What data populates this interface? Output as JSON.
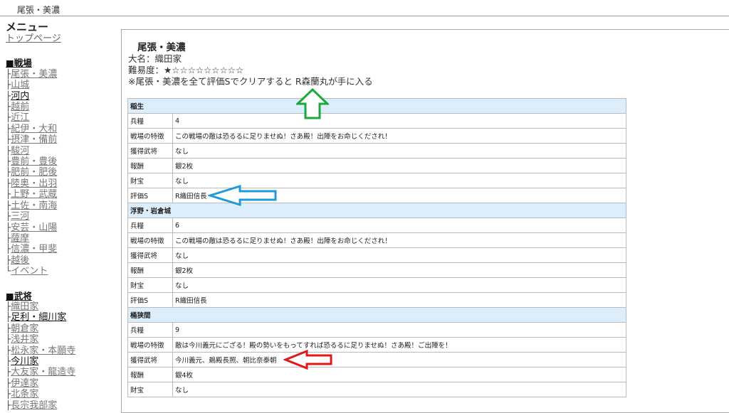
{
  "breadcrumb": "尾張・美濃",
  "sidebar": {
    "menu_title": "メニュー",
    "top_link": "トップページ",
    "sections": [
      {
        "title": "■戦場",
        "items": [
          {
            "tee": "├",
            "label": "尾張・美濃"
          },
          {
            "tee": "├",
            "label": "山城"
          },
          {
            "tee": "├",
            "label": "河内"
          },
          {
            "tee": "├",
            "label": "越前"
          },
          {
            "tee": "├",
            "label": "近江"
          },
          {
            "tee": "├",
            "label": "紀伊・大和"
          },
          {
            "tee": "├",
            "label": "摂津・備前"
          },
          {
            "tee": "├",
            "label": "駿河"
          },
          {
            "tee": "├",
            "label": "豊前・豊後"
          },
          {
            "tee": "├",
            "label": "肥前・肥後"
          },
          {
            "tee": "├",
            "label": "陸奥・出羽"
          },
          {
            "tee": "├",
            "label": "上野・武蔵"
          },
          {
            "tee": "├",
            "label": "土佐・南海"
          },
          {
            "tee": "├",
            "label": "三河"
          },
          {
            "tee": "├",
            "label": "安芸・山陽"
          },
          {
            "tee": "├",
            "label": "薩摩"
          },
          {
            "tee": "├",
            "label": "信濃・甲斐"
          },
          {
            "tee": "├",
            "label": "越後"
          },
          {
            "tee": "└",
            "label": "イベント"
          }
        ]
      },
      {
        "title": "■武将",
        "items": [
          {
            "tee": "├",
            "label": "織田家"
          },
          {
            "tee": "├",
            "label": "足利・細川家"
          },
          {
            "tee": "├",
            "label": "朝倉家"
          },
          {
            "tee": "├",
            "label": "浅井家"
          },
          {
            "tee": "├",
            "label": "松永家・本願寺"
          },
          {
            "tee": "├",
            "label": "今川家"
          },
          {
            "tee": "├",
            "label": "大友家・龍造寺"
          },
          {
            "tee": "├",
            "label": "伊達家"
          },
          {
            "tee": "├",
            "label": "北条家"
          },
          {
            "tee": "├",
            "label": "長宗我部家"
          }
        ]
      }
    ]
  },
  "main": {
    "title": "尾張・美濃",
    "daimyo": "大名：織田家",
    "difficulty": "難易度：★☆☆☆☆☆☆☆☆☆",
    "note": "※尾張・美濃を全て評価Sでクリアすると R森蘭丸が手に入る",
    "rows": [
      {
        "hdr": true,
        "k": "稲生",
        "v": ""
      },
      {
        "k": "兵糧",
        "v": "4"
      },
      {
        "k": "戦場の特徴",
        "v": "この戦場の敵は恐るるに足りませぬ！さあ殿！出陣をお命じくだされ！"
      },
      {
        "k": "獲得武将",
        "v": "なし"
      },
      {
        "k": "報酬",
        "v": "銀2枚"
      },
      {
        "k": "財宝",
        "v": "なし"
      },
      {
        "k": "評価S",
        "v": "R織田信長"
      },
      {
        "hdr": true,
        "k": "浮野・岩倉城",
        "v": ""
      },
      {
        "k": "兵糧",
        "v": "6"
      },
      {
        "k": "戦場の特徴",
        "v": "この戦場の敵は恐るるに足りませぬ！さあ殿！出陣をお命じくだされ！"
      },
      {
        "k": "獲得武将",
        "v": "なし"
      },
      {
        "k": "報酬",
        "v": "銀2枚"
      },
      {
        "k": "財宝",
        "v": "なし"
      },
      {
        "k": "評価S",
        "v": "R織田信長"
      },
      {
        "hdr": true,
        "k": "桶狭間",
        "v": ""
      },
      {
        "k": "兵糧",
        "v": "9"
      },
      {
        "k": "戦場の特徴",
        "v": "敵は今川義元にござる！殿の勢いをもってすれば恐るるに足りませぬ！さあ殿！ご出陣を！"
      },
      {
        "k": "獲得武将",
        "v": "今川義元、鵜殿長照、朝比奈泰朝"
      },
      {
        "k": "報酬",
        "v": "銀4枚"
      },
      {
        "k": "財宝",
        "v": "なし"
      }
    ]
  },
  "colors": {
    "header_row_bg": "#dceefb",
    "arrow_green": "#1aa83a",
    "arrow_blue": "#1e9ad6",
    "arrow_red": "#e01818"
  }
}
